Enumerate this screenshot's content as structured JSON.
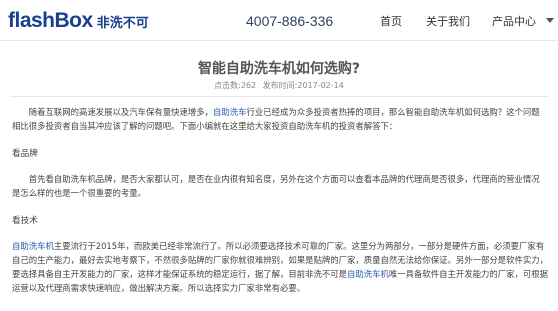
{
  "header": {
    "logo_en": "flashBox",
    "logo_cn": "非洗不可",
    "phone": "4007-886-336",
    "nav": [
      "首页",
      "关于我们",
      "产品中心"
    ]
  },
  "article": {
    "title": "智能自助洗车机如何选购?",
    "meta_views": "点击数:262",
    "meta_date": "发布时间:2017-02-14",
    "para1_a": "随着互联网的高速发展以及汽车保有量快速增多，",
    "para1_link": "自助洗车",
    "para1_b": "行业已经成为众多投资者热捧的项目，那么智能自助洗车机如何选购？这个问题相比很多投资者自当其冲应该了解的问题吧。下面小编就在这里给大家投资自助洗车机的投资者解答下：",
    "sub1": "看品牌",
    "para2": "首先看自助洗车机品牌，是否大家都认可，是否在业内很有知名度，另外在这个方面可以查看本品牌的代理商是否很多，代理商的营业情况是怎么样的也是一个很重要的考量。",
    "sub2": "看技术",
    "para3_link1": "自助洗车机",
    "para3_a": "主要流行于2015年，而欧美已经非常流行了。所以必须要选择技术可靠的厂家。这里分为两部分，一部分是硬件方面，必须要厂家有自己的生产能力，最好去实地考察下，不然很多贴牌的厂家你就很难辨别，如果是贴牌的厂家，质量自然无法给你保证。另外一部分是软件实力，要选择具备自主开发能力的厂家，这样才能保证系统的稳定运行，据了解，目前非洗不可是",
    "para3_link2": "自助洗车机",
    "para3_b": "唯一具备软件自主开发能力的厂家，可根据运营以及代理商需求快速响应，做出解决方案。所以选择实力厂家非常有必要。"
  },
  "colors": {
    "brand": "#1a3f8f",
    "link": "#2a5db0"
  }
}
